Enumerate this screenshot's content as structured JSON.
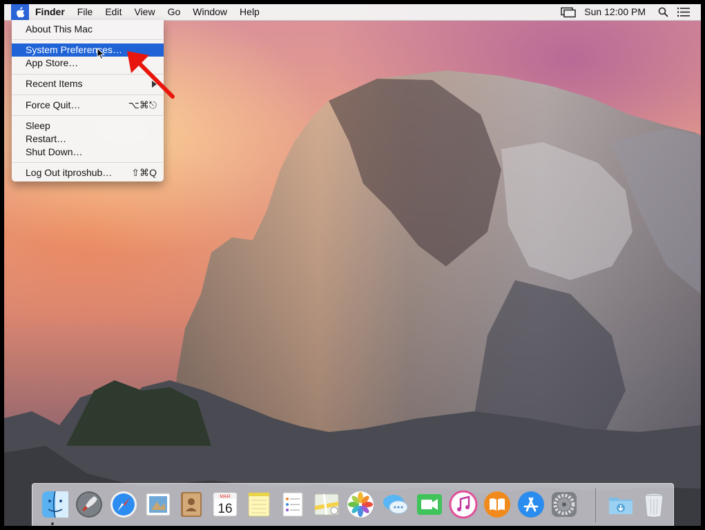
{
  "menubar": {
    "apple_icon": "apple-logo-icon",
    "app_name": "Finder",
    "menus": [
      "File",
      "Edit",
      "View",
      "Go",
      "Window",
      "Help"
    ],
    "clock": "Sun 12:00 PM",
    "status_icons": [
      "display-mirroring-icon",
      "spotlight-icon",
      "notification-center-icon"
    ]
  },
  "apple_menu": {
    "about": "About This Mac",
    "system_preferences": "System Preferences…",
    "app_store": "App Store…",
    "recent_items": "Recent Items",
    "force_quit": "Force Quit…",
    "force_quit_shortcut": "⌥⌘⎋",
    "sleep": "Sleep",
    "restart": "Restart…",
    "shut_down": "Shut Down…",
    "log_out": "Log Out itproshub…",
    "log_out_shortcut": "⇧⌘Q",
    "highlighted_item": "System Preferences…"
  },
  "calendar_icon": {
    "month": "MAR",
    "day": "16"
  },
  "dock": {
    "apps": [
      "Finder",
      "Launchpad",
      "Safari",
      "Mail",
      "Contacts",
      "Calendar",
      "Notes",
      "Reminders",
      "Maps",
      "Photos",
      "Messages",
      "FaceTime",
      "iTunes",
      "iBooks",
      "App Store",
      "System Preferences",
      "Downloads",
      "Trash"
    ]
  },
  "colors": {
    "selection": "#1f63d6",
    "annotation_arrow": "#e8160c",
    "menubar_bg": "#f3f3f3"
  }
}
